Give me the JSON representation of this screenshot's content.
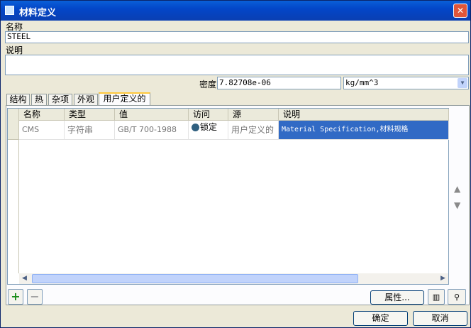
{
  "window": {
    "title": "材料定义",
    "close_icon": "close-icon"
  },
  "name": {
    "label": "名称",
    "value": "STEEL"
  },
  "description": {
    "label": "说明",
    "value": ""
  },
  "density": {
    "label": "密度",
    "value": "7.82708e-06",
    "unit": "kg/mm^3"
  },
  "tabs": [
    {
      "label": "结构"
    },
    {
      "label": "热"
    },
    {
      "label": "杂项"
    },
    {
      "label": "外观"
    },
    {
      "label": "用户定义的",
      "active": true
    }
  ],
  "table": {
    "columns": [
      "名称",
      "类型",
      "值",
      "访问",
      "源",
      "说明"
    ],
    "rows": [
      {
        "name": "CMS",
        "type": "字符串",
        "value": "GB/T 700-1988",
        "access": "锁定",
        "source": "用户定义的",
        "description": "Material Specification,材料规格"
      }
    ]
  },
  "buttons": {
    "add": "+",
    "remove": "−",
    "properties": "属性...",
    "ok": "确定",
    "cancel": "取消"
  },
  "colors": {
    "selection": "#316ac5",
    "titlebar": "#0346c8",
    "add_icon": "#1a8c1a"
  }
}
